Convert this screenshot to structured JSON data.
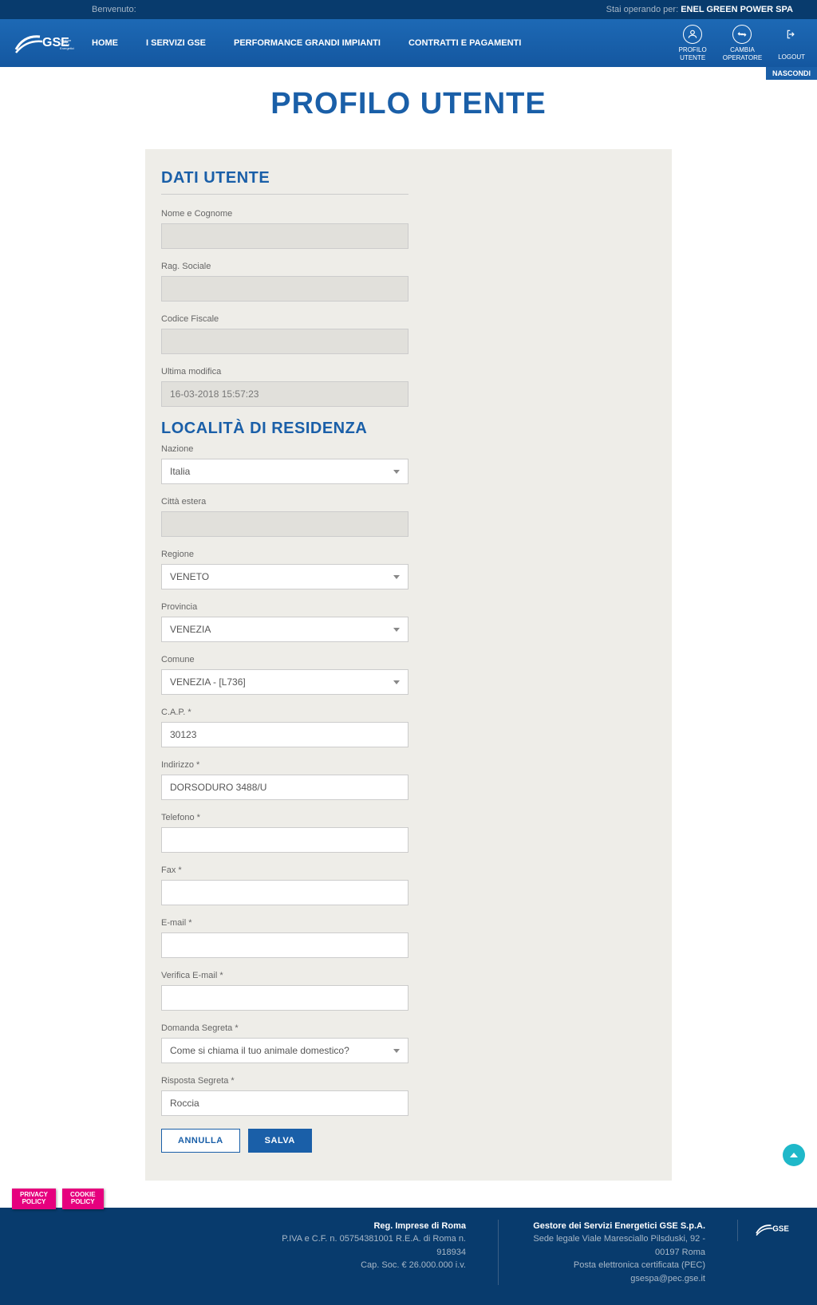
{
  "topbar": {
    "welcome": "Benvenuto:",
    "operating_prefix": "Stai operando per: ",
    "operating_company": "ENEL GREEN POWER SPA"
  },
  "nav": {
    "home": "HOME",
    "servizi": "I SERVIZI GSE",
    "performance": "PERFORMANCE GRANDI IMPIANTI",
    "contratti": "CONTRATTI E PAGAMENTI",
    "profilo_l1": "PROFILO",
    "profilo_l2": "UTENTE",
    "cambia_l1": "CAMBIA",
    "cambia_l2": "OPERATORE",
    "logout": "LOGOUT"
  },
  "nascondi": "NASCONDI",
  "page_title": "PROFILO UTENTE",
  "sections": {
    "dati_utente": "DATI UTENTE",
    "localita": "LOCALITÀ DI RESIDENZA"
  },
  "labels": {
    "nome": "Nome e Cognome",
    "rag_sociale": "Rag. Sociale",
    "codice_fiscale": "Codice Fiscale",
    "ultima_modifica": "Ultima modifica",
    "nazione": "Nazione",
    "citta_estera": "Città estera",
    "regione": "Regione",
    "provincia": "Provincia",
    "comune": "Comune",
    "cap": "C.A.P. *",
    "indirizzo": "Indirizzo *",
    "telefono": "Telefono *",
    "fax": "Fax *",
    "email": "E-mail *",
    "verifica_email": "Verifica E-mail *",
    "domanda_segreta": "Domanda Segreta *",
    "risposta_segreta": "Risposta Segreta *"
  },
  "values": {
    "nome": "",
    "rag_sociale": "",
    "codice_fiscale": "",
    "ultima_modifica": "16-03-2018 15:57:23",
    "nazione": "Italia",
    "citta_estera": "",
    "regione": "VENETO",
    "provincia": "VENEZIA",
    "comune": "VENEZIA - [L736]",
    "cap": "30123",
    "indirizzo": "DORSODURO 3488/U",
    "telefono": "",
    "fax": "",
    "email": "",
    "verifica_email": "",
    "domanda_segreta": "Come si chiama il tuo animale domestico?",
    "risposta_segreta": "Roccia"
  },
  "buttons": {
    "annulla": "ANNULLA",
    "salva": "SALVA"
  },
  "policy": {
    "privacy_l1": "PRIVACY",
    "privacy_l2": "POLICY",
    "cookie_l1": "COOKIE",
    "cookie_l2": "POLICY"
  },
  "footer": {
    "col1_title": "Reg. Imprese di Roma",
    "col1_l1": "P.IVA e C.F. n. 05754381001 R.E.A. di Roma n. 918934",
    "col1_l2": "Cap. Soc. € 26.000.000 i.v.",
    "col2_title": "Gestore dei Servizi Energetici GSE S.p.A.",
    "col2_l1": "Sede legale Viale Maresciallo Pilsduski, 92 - 00197 Roma",
    "col2_l2": "Posta elettronica certificata (PEC) gsespa@pec.gse.it"
  }
}
